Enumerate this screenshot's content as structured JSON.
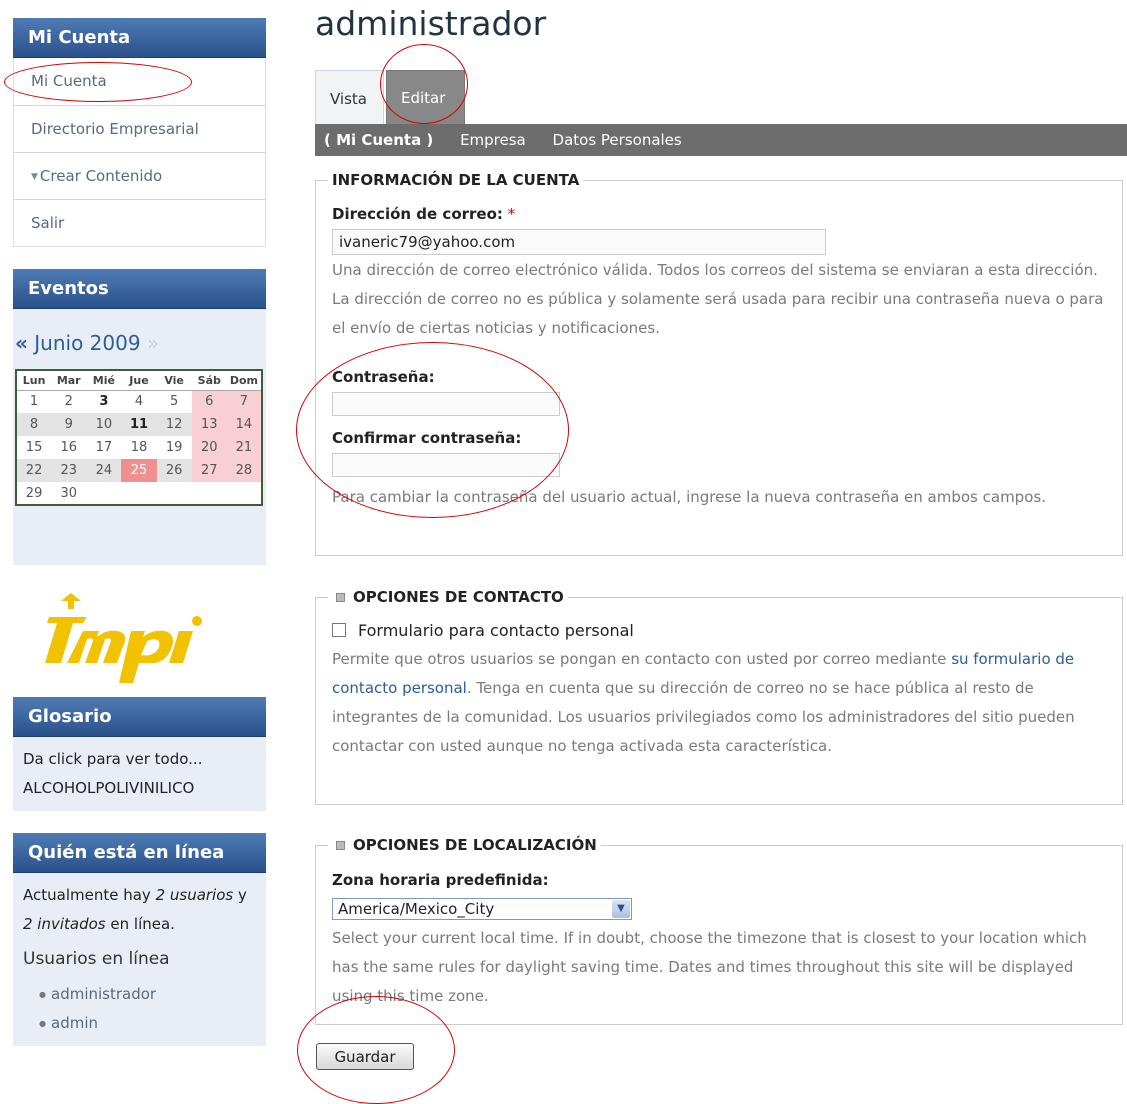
{
  "sidebar": {
    "account": {
      "title": "Mi Cuenta",
      "items": [
        {
          "label": "Mi Cuenta"
        },
        {
          "label": "Directorio Empresarial"
        },
        {
          "label": "Crear Contenido",
          "icon": "triangle-down-icon"
        },
        {
          "label": "Salir"
        }
      ]
    },
    "events": {
      "title": "Eventos",
      "prev": "«",
      "month": "Junio 2009",
      "next": "»",
      "weekdays": [
        "Lun",
        "Mar",
        "Mié",
        "Jue",
        "Vie",
        "Sáb",
        "Dom"
      ],
      "weeks": [
        [
          "1",
          "2",
          "3",
          "4",
          "5",
          "6",
          "7"
        ],
        [
          "8",
          "9",
          "10",
          "11",
          "12",
          "13",
          "14"
        ],
        [
          "15",
          "16",
          "17",
          "18",
          "19",
          "20",
          "21"
        ],
        [
          "22",
          "23",
          "24",
          "25",
          "26",
          "27",
          "28"
        ],
        [
          "29",
          "30",
          "",
          "",
          "",
          "",
          ""
        ]
      ],
      "bold_days": [
        "3",
        "11"
      ],
      "today": "25"
    },
    "glossary": {
      "title": "Glosario",
      "link": "Da click para ver todo...",
      "term": "ALCOHOLPOLIVINILICO"
    },
    "online": {
      "title": "Quién está en línea",
      "text_a": "Actualmente hay ",
      "users": "2 usuarios",
      "text_b": " y ",
      "guests": "2 invitados",
      "text_c": " en línea.",
      "subtitle": "Usuarios en línea",
      "users_list": [
        "administrador",
        "admin"
      ]
    }
  },
  "main": {
    "title": "administrador",
    "tabs": [
      {
        "label": "Vista"
      },
      {
        "label": "Editar"
      }
    ],
    "subtabs": [
      "( Mi Cuenta )",
      "Empresa",
      "Datos Personales"
    ],
    "account_info": {
      "legend": "INFORMACIÓN DE LA CUENTA",
      "email_label": "Dirección de correo:",
      "required_mark": "*",
      "email_value": "ivaneric79@yahoo.com",
      "email_desc": "Una dirección de correo electrónico válida. Todos los correos del sistema se enviaran a esta dirección. La dirección de correo no es pública y solamente será usada para recibir una contraseña nueva o para el envío de ciertas noticias y notificaciones.",
      "password_label": "Contraseña:",
      "confirm_label": "Confirmar contraseña:",
      "password_desc": "Para cambiar la contraseña del usuario actual, ingrese la nueva contraseña en ambos campos."
    },
    "contact": {
      "legend": "OPCIONES DE CONTACTO",
      "checkbox_label": "Formulario para contacto personal",
      "desc_a": "Permite que otros usuarios se pongan en contacto con usted por correo mediante ",
      "desc_link": "su formulario de contacto personal",
      "desc_b": ". Tenga en cuenta que su dirección de correo no se hace pública al resto de integrantes de la comunidad. Los usuarios privilegiados como los administradores del sitio pueden contactar con usted aunque no tenga activada esta característica."
    },
    "locale": {
      "legend": "OPCIONES DE LOCALIZACIÓN",
      "tz_label": "Zona horaria predefinida:",
      "tz_value": "America/Mexico_City",
      "tz_desc": "Select your current local time. If in doubt, choose the timezone that is closest to your location which has the same rules for daylight saving time. Dates and times throughout this site will be displayed using this time zone."
    },
    "save_label": "Guardar"
  },
  "colors": {
    "block_header": "#2a528c",
    "subtabs_bg": "#6d6d6d",
    "annotation": "#d40000",
    "logo": "#f2c200"
  }
}
